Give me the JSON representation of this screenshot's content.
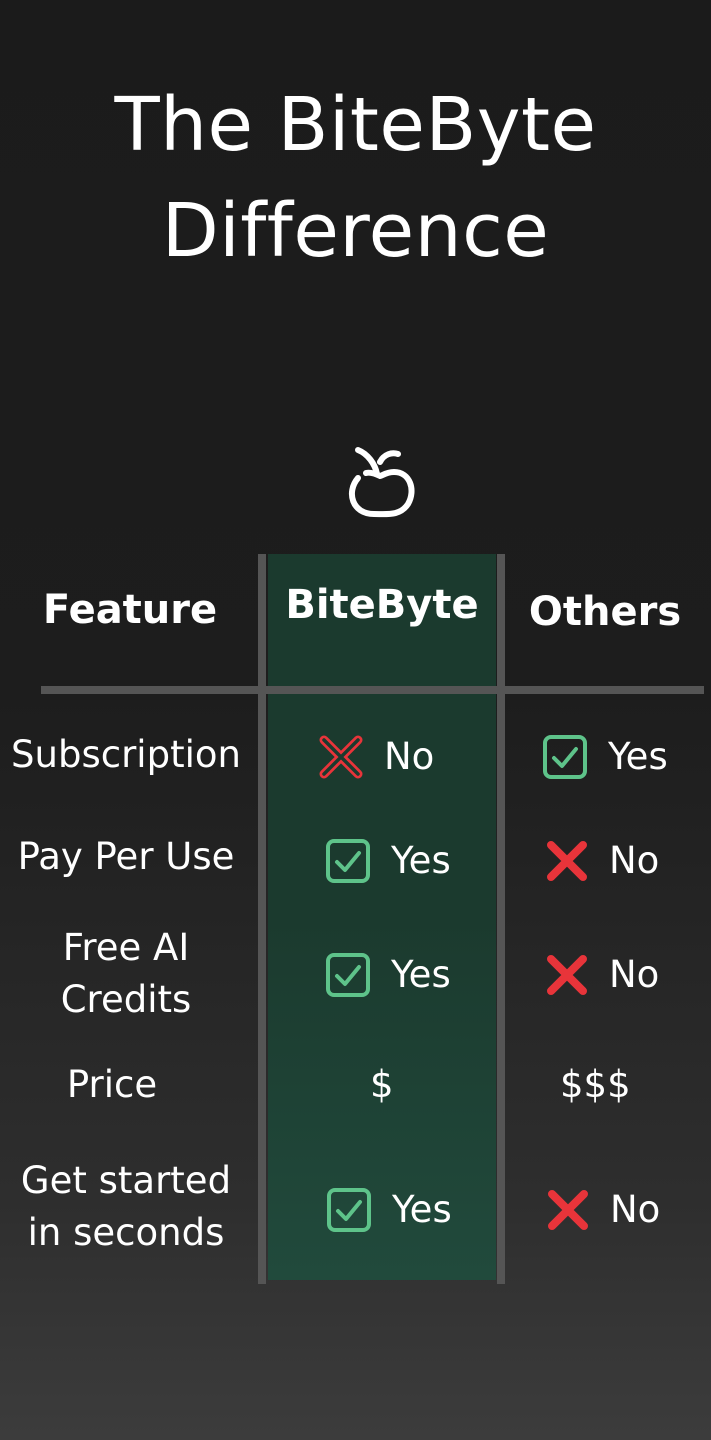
{
  "title_line1": "The BiteByte",
  "title_line2": "Difference",
  "logo_icon": "apple-icon",
  "headers": {
    "feature": "Feature",
    "bitebyte": "BiteByte",
    "others": "Others"
  },
  "colors": {
    "highlight": "#1b3a2e",
    "check": "#5ec38a",
    "cross": "#e8343a",
    "divider": "#555555"
  },
  "rows": [
    {
      "feature": "Subscription",
      "bitebyte": {
        "icon": "cross-outline-icon",
        "text": "No"
      },
      "others": {
        "icon": "check-box-icon",
        "text": "Yes"
      }
    },
    {
      "feature": "Pay Per Use",
      "bitebyte": {
        "icon": "check-box-icon",
        "text": "Yes"
      },
      "others": {
        "icon": "cross-icon",
        "text": "No"
      }
    },
    {
      "feature_line1": "Free AI",
      "feature_line2": "Credits",
      "bitebyte": {
        "icon": "check-box-icon",
        "text": "Yes"
      },
      "others": {
        "icon": "cross-icon",
        "text": "No"
      }
    },
    {
      "feature": "Price",
      "bitebyte": {
        "text": "$"
      },
      "others": {
        "text": "$$$"
      }
    },
    {
      "feature_line1": "Get started",
      "feature_line2": "in seconds",
      "bitebyte": {
        "icon": "check-box-icon",
        "text": "Yes"
      },
      "others": {
        "icon": "cross-icon",
        "text": "No"
      }
    }
  ]
}
